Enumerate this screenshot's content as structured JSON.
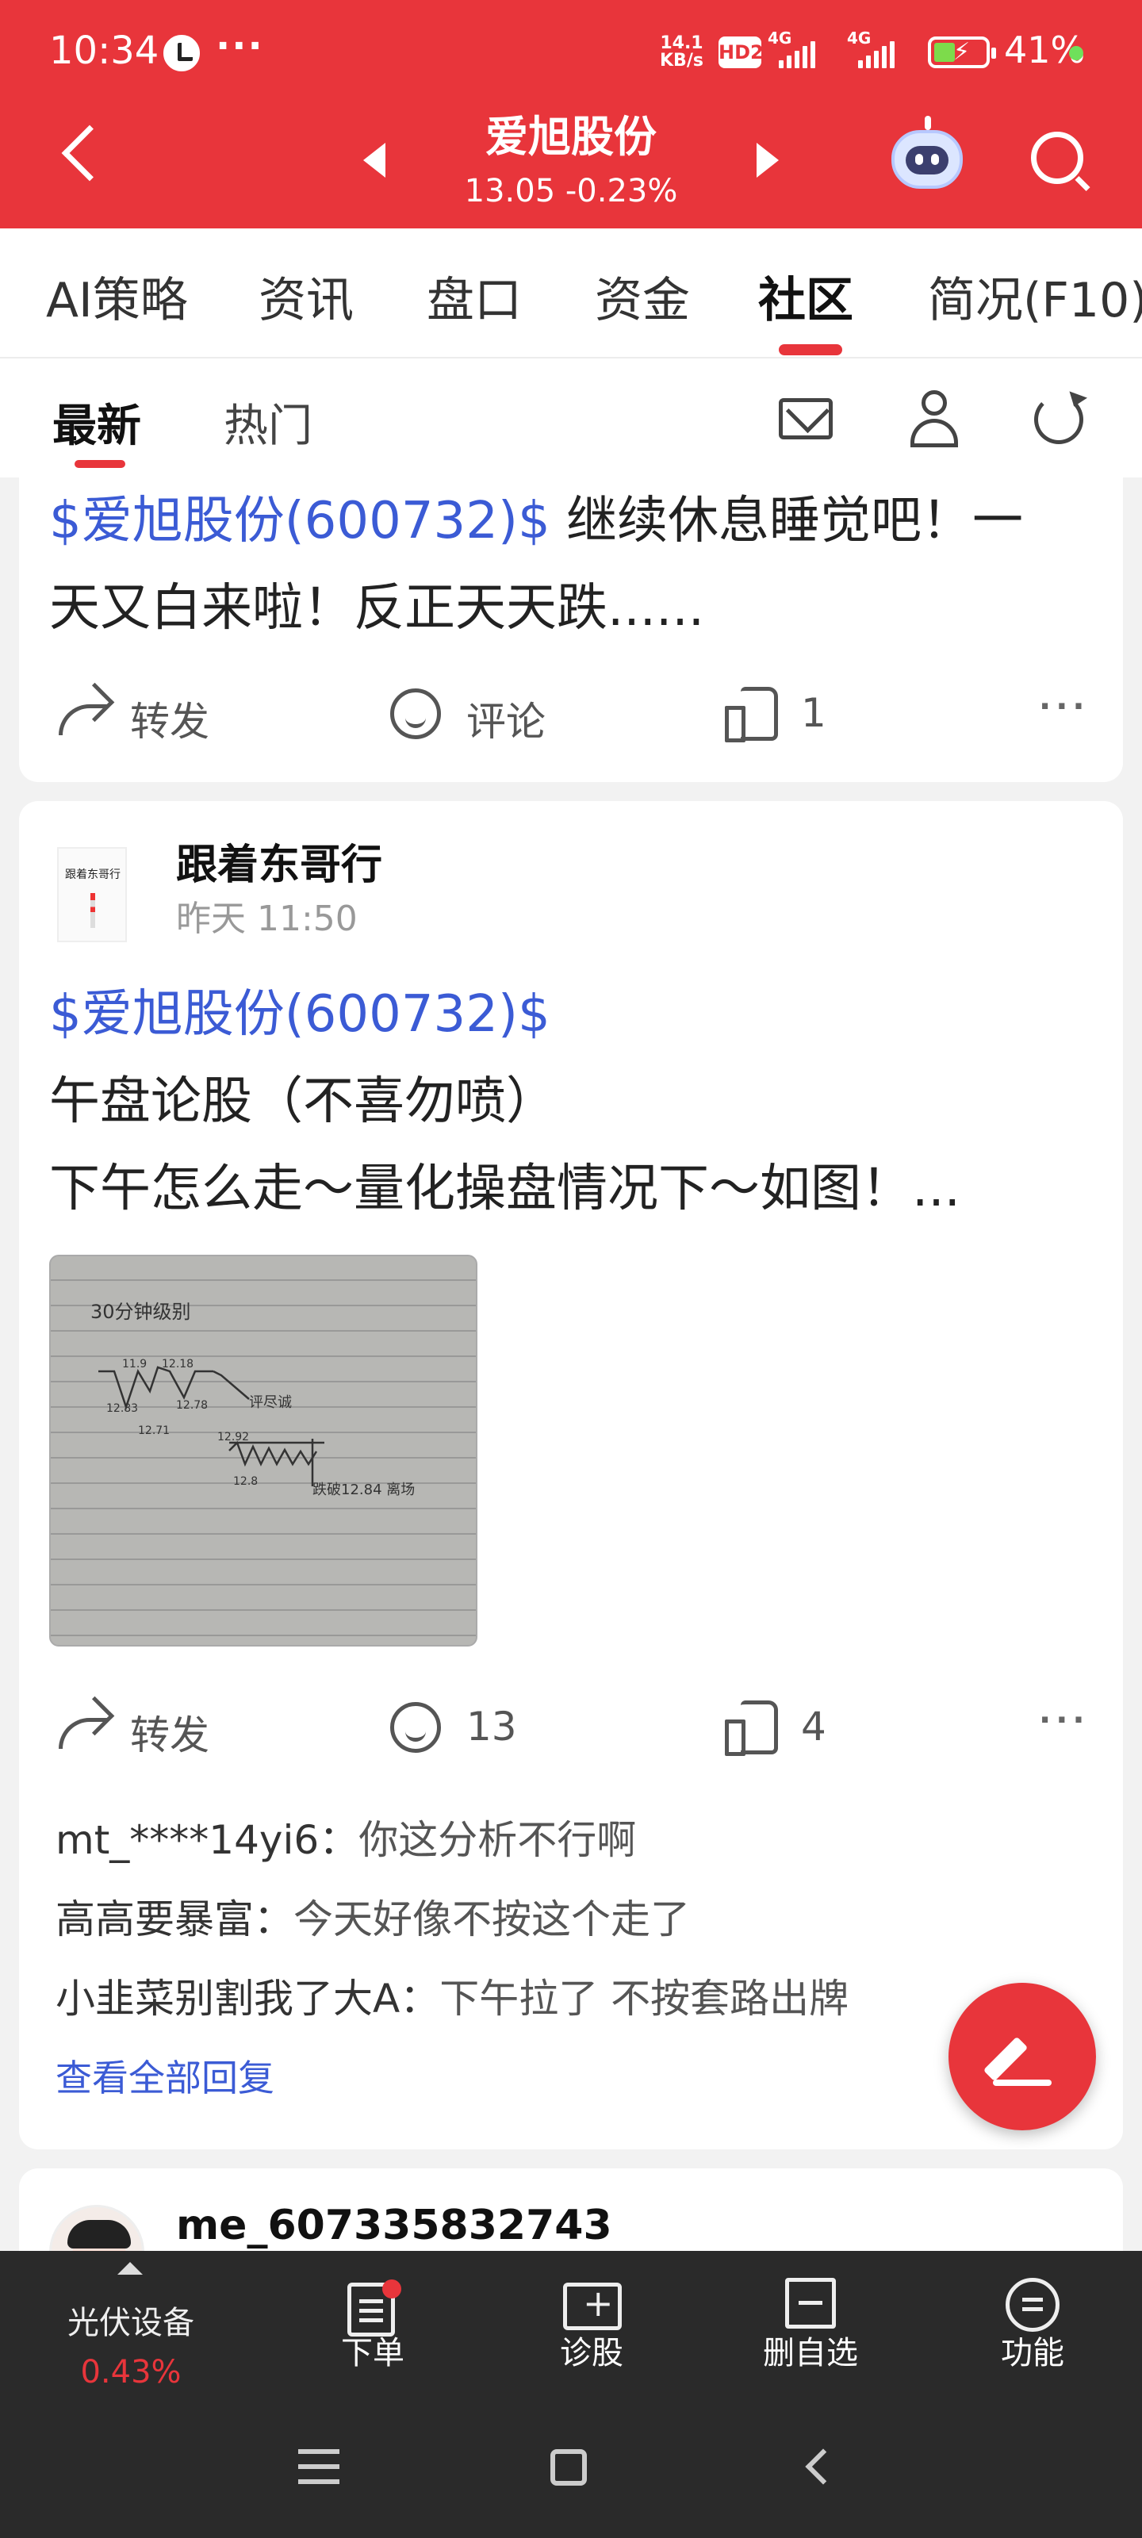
{
  "status_bar": {
    "time": "10:34",
    "dots": "···",
    "net_speed_value": "14.1",
    "net_speed_unit": "KB/s",
    "hd": "HD2",
    "network_1": "4G",
    "network_2": "4G",
    "battery_pct": "41%",
    "battery_color": "#7ddb4b"
  },
  "header": {
    "title": "爱旭股份",
    "price_line": "13.05 -0.23%",
    "bg_color": "#e8353b"
  },
  "tabs": [
    {
      "label": "AI策略"
    },
    {
      "label": "资讯"
    },
    {
      "label": "盘口"
    },
    {
      "label": "资金"
    },
    {
      "label": "社区",
      "active": true
    },
    {
      "label": "简况(F10)"
    }
  ],
  "subtabs": [
    {
      "label": "最新",
      "active": true
    },
    {
      "label": "热门"
    }
  ],
  "post1": {
    "stock_tag": "$爱旭股份(600732)$",
    "text_line1": " 继续休息睡觉吧！一",
    "text_line2": "天又白来啦！反正天天跌......",
    "share_label": "转发",
    "comment_label": "评论",
    "like_count": "1",
    "more": "···"
  },
  "post2": {
    "author": "跟着东哥行",
    "time": "昨天 11:50",
    "stock_tag": "$爱旭股份(600732)$",
    "line2": "午盘论股（不喜勿喷）",
    "line3": "下午怎么走～量化操盘情况下～如图！...",
    "share_label": "转发",
    "comment_count": "13",
    "like_count": "4",
    "more": "···",
    "replies": [
      {
        "user": "mt_****14yi6：",
        "text": "你这分析不行啊"
      },
      {
        "user": "高高要暴富：",
        "text": "今天好像不按这个走了"
      },
      {
        "user": "小韭菜别割我了大A：",
        "text": "下午拉了 不按套路出牌"
      }
    ],
    "view_all": "查看全部回复",
    "note_image": {
      "title": "30分钟级别",
      "labels": [
        "11.9",
        "12.18",
        "12.83",
        "12.78",
        "12.71",
        "12.92",
        "12.8",
        "评尽诚",
        "跌破12.84 离场"
      ]
    }
  },
  "post3": {
    "author": "me_607335832743"
  },
  "bottom_bar": {
    "sector_name": "光伏设备",
    "sector_change": "0.43%",
    "items": [
      {
        "label": "下单"
      },
      {
        "label": "诊股"
      },
      {
        "label": "删自选"
      },
      {
        "label": "功能"
      }
    ]
  }
}
